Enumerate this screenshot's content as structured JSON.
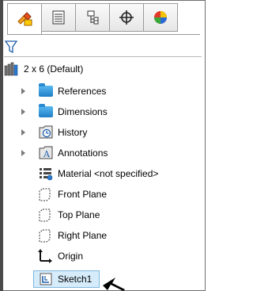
{
  "toolbar": {
    "tabs": [
      {
        "icon": "feature-manager-icon",
        "label": "FeatureManager",
        "active": true
      },
      {
        "icon": "property-manager-icon",
        "label": "PropertyManager"
      },
      {
        "icon": "configuration-manager-icon",
        "label": "ConfigurationManager"
      },
      {
        "icon": "dimxpert-manager-icon",
        "label": "DimXpertManager"
      },
      {
        "icon": "display-manager-icon",
        "label": "DisplayManager"
      }
    ]
  },
  "filter": {
    "icon": "filter-icon"
  },
  "tree": {
    "root": {
      "label": "2 x 6  (Default)",
      "icon": "part-icon"
    },
    "items": [
      {
        "label": "References",
        "icon": "folder-icon",
        "expandable": true
      },
      {
        "label": "Dimensions",
        "icon": "folder-icon",
        "expandable": true
      },
      {
        "label": "History",
        "icon": "history-icon",
        "expandable": true
      },
      {
        "label": "Annotations",
        "icon": "annotations-icon",
        "expandable": true
      },
      {
        "label": "Material <not specified>",
        "icon": "material-icon",
        "expandable": false
      },
      {
        "label": "Front Plane",
        "icon": "plane-icon",
        "expandable": false
      },
      {
        "label": "Top Plane",
        "icon": "plane-icon",
        "expandable": false
      },
      {
        "label": "Right Plane",
        "icon": "plane-icon",
        "expandable": false
      },
      {
        "label": "Origin",
        "icon": "origin-icon",
        "expandable": false
      },
      {
        "label": "Sketch1",
        "icon": "sketch-icon",
        "expandable": false,
        "selected": true
      }
    ]
  },
  "colors": {
    "selection": "#d6ecfa",
    "folder": "#2a8ad0"
  }
}
